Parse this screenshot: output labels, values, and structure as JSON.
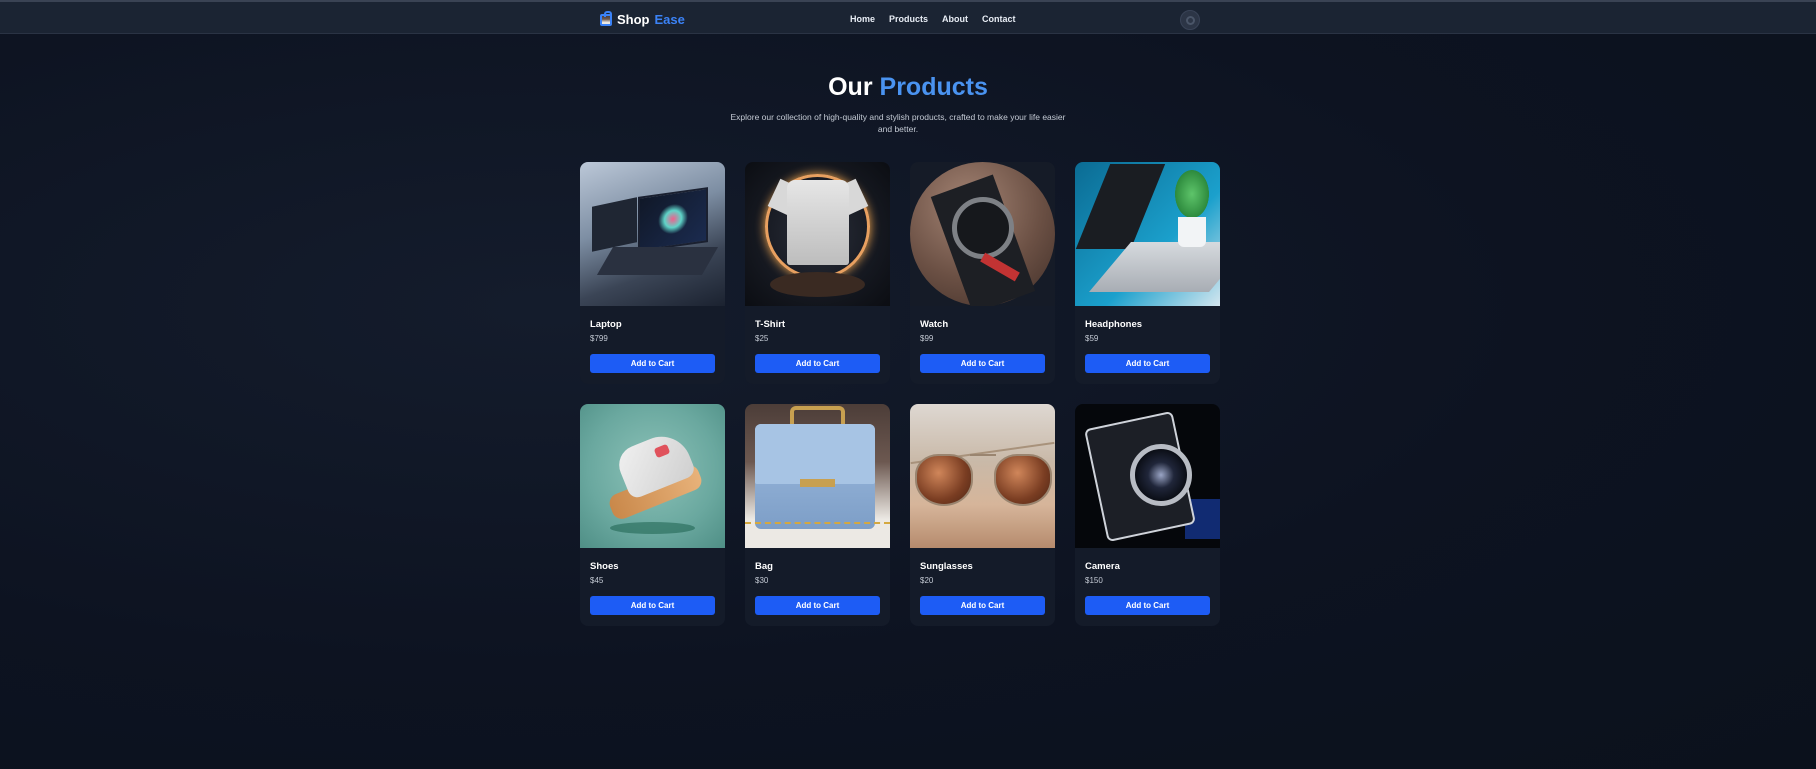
{
  "brand": {
    "part1": "Shop",
    "part2": "Ease"
  },
  "nav": {
    "home": "Home",
    "products": "Products",
    "about": "About",
    "contact": "Contact"
  },
  "hero": {
    "title_part1": "Our",
    "title_part2": "Products",
    "subtitle": "Explore our collection of high-quality and stylish products, crafted to make your life easier and better."
  },
  "colors": {
    "accent": "#3b82f6",
    "button": "#1d5cf5",
    "background": "#0d1321"
  },
  "products": [
    {
      "name": "Laptop",
      "price": "$799",
      "button": "Add to Cart",
      "image": "laptop-image"
    },
    {
      "name": "T-Shirt",
      "price": "$25",
      "button": "Add to Cart",
      "image": "tshirt-image"
    },
    {
      "name": "Watch",
      "price": "$99",
      "button": "Add to Cart",
      "image": "watch-image"
    },
    {
      "name": "Headphones",
      "price": "$59",
      "button": "Add to Cart",
      "image": "headphones-image"
    },
    {
      "name": "Shoes",
      "price": "$45",
      "button": "Add to Cart",
      "image": "shoes-image"
    },
    {
      "name": "Bag",
      "price": "$30",
      "button": "Add to Cart",
      "image": "bag-image"
    },
    {
      "name": "Sunglasses",
      "price": "$20",
      "button": "Add to Cart",
      "image": "sunglasses-image"
    },
    {
      "name": "Camera",
      "price": "$150",
      "button": "Add to Cart",
      "image": "camera-image"
    }
  ]
}
